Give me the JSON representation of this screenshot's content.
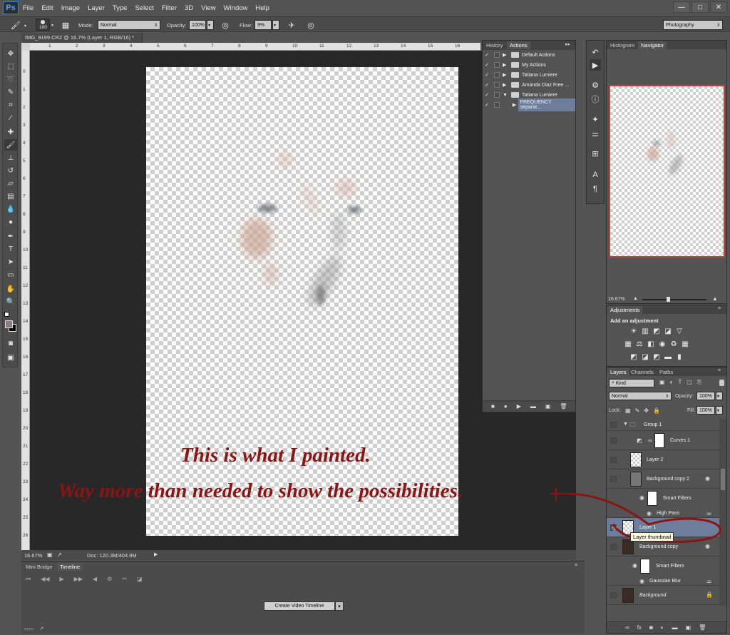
{
  "app": {
    "logo": "Ps"
  },
  "menu": [
    "File",
    "Edit",
    "Image",
    "Layer",
    "Type",
    "Select",
    "Filter",
    "3D",
    "View",
    "Window",
    "Help"
  ],
  "window_controls": {
    "minimize": "—",
    "restore": "□",
    "close": "✕"
  },
  "options": {
    "brush_size": "100",
    "mode_label": "Mode:",
    "mode_value": "Normal",
    "opacity_label": "Opacity:",
    "opacity_value": "100%",
    "flow_label": "Flow:",
    "flow_value": "9%",
    "workspace": "Photography"
  },
  "document": {
    "tab_title": "IMG_9199.CR2 @ 16.7% (Layer 1, RGB/16) *",
    "zoom": "16.67%",
    "doc_info": "Doc: 120.3M/404.9M"
  },
  "ruler": {
    "top": [
      "1",
      "2",
      "3",
      "4",
      "5",
      "6",
      "7",
      "8",
      "9",
      "10",
      "11",
      "12",
      "13",
      "14",
      "15",
      "16"
    ],
    "left": [
      "0",
      "1",
      "2",
      "3",
      "4",
      "5",
      "6",
      "7",
      "8",
      "9",
      "10",
      "11",
      "12",
      "13",
      "14",
      "15",
      "16",
      "17",
      "18",
      "19",
      "20",
      "21",
      "22",
      "23",
      "24",
      "25",
      "26"
    ]
  },
  "bottom_panel": {
    "tabs": [
      "Mini Bridge",
      "Timeline"
    ],
    "create_button": "Create Video Timeline"
  },
  "actions_panel": {
    "tabs": [
      "History",
      "Actions"
    ],
    "rows": [
      {
        "label": "Default Actions",
        "type": "set"
      },
      {
        "label": "My Actions",
        "type": "set"
      },
      {
        "label": "Tatiana Lumiere",
        "type": "set"
      },
      {
        "label": "Amanda Diaz Free ...",
        "type": "set"
      },
      {
        "label": "Tatiana Lumiere",
        "type": "set-open"
      },
      {
        "label": "FREQUENCY separat...",
        "type": "action"
      }
    ]
  },
  "navigator_panel": {
    "tabs": [
      "Histogram",
      "Navigator"
    ],
    "zoom": "16.67%"
  },
  "adjustments_panel": {
    "tab": "Adjustments",
    "heading": "Add an adjustment"
  },
  "layers_panel": {
    "tabs": [
      "Layers",
      "Channels",
      "Paths"
    ],
    "filter_kind": "Kind",
    "blend_mode": "Normal",
    "opacity_label": "Opacity:",
    "opacity_value": "100%",
    "lock_label": "Lock:",
    "fill_label": "Fill:",
    "fill_value": "100%",
    "layers": [
      {
        "name": "Group 1"
      },
      {
        "name": "Curves 1"
      },
      {
        "name": "Layer 2"
      },
      {
        "name": "Background copy 2"
      },
      {
        "name": "Smart Filters"
      },
      {
        "name": "High Pass"
      },
      {
        "name": "Layer 1"
      },
      {
        "name": "Background copy"
      },
      {
        "name": "Smart Filters"
      },
      {
        "name": "Gaussian Blur"
      },
      {
        "name": "Background"
      }
    ],
    "tooltip": "Layer thumbnail"
  },
  "annotations": {
    "line1": "This is what I painted.",
    "line2": "Way more than needed to show the possibilities."
  }
}
